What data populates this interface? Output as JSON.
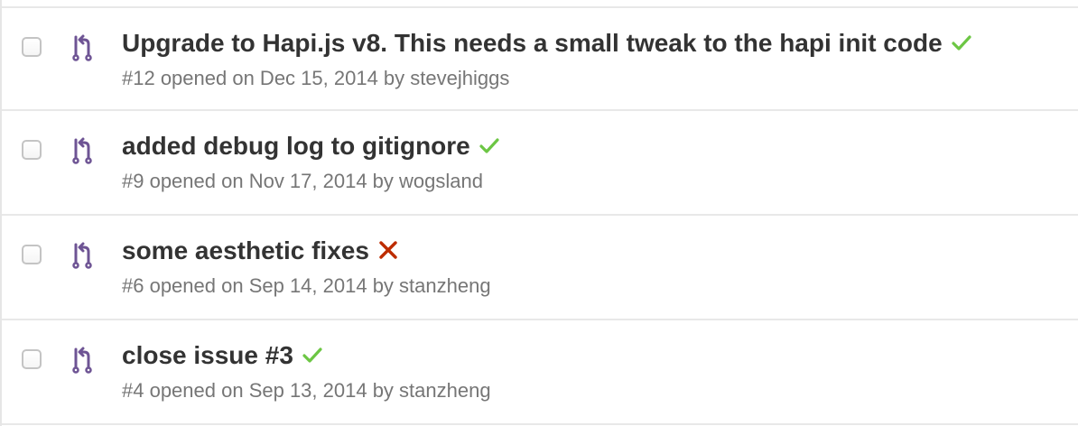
{
  "pull_requests": [
    {
      "title": "Upgrade to Hapi.js v8. This needs a small tweak to the hapi init code",
      "meta": "#12 opened on Dec 15, 2014 by stevejhiggs",
      "status": "success",
      "status_icon": "check-icon",
      "status_color": "#6cc644"
    },
    {
      "title": "added debug log to gitignore",
      "meta": "#9 opened on Nov 17, 2014 by wogsland",
      "status": "success",
      "status_icon": "check-icon",
      "status_color": "#6cc644"
    },
    {
      "title": "some aesthetic fixes",
      "meta": "#6 opened on Sep 14, 2014 by stanzheng",
      "status": "failure",
      "status_icon": "x-icon",
      "status_color": "#bd2c00"
    },
    {
      "title": "close issue #3",
      "meta": "#4 opened on Sep 13, 2014 by stanzheng",
      "status": "success",
      "status_icon": "check-icon",
      "status_color": "#6cc644"
    }
  ],
  "colors": {
    "pr_icon": "#6e5494",
    "title": "#333333",
    "meta": "#767676",
    "success": "#6cc644",
    "failure": "#bd2c00"
  }
}
